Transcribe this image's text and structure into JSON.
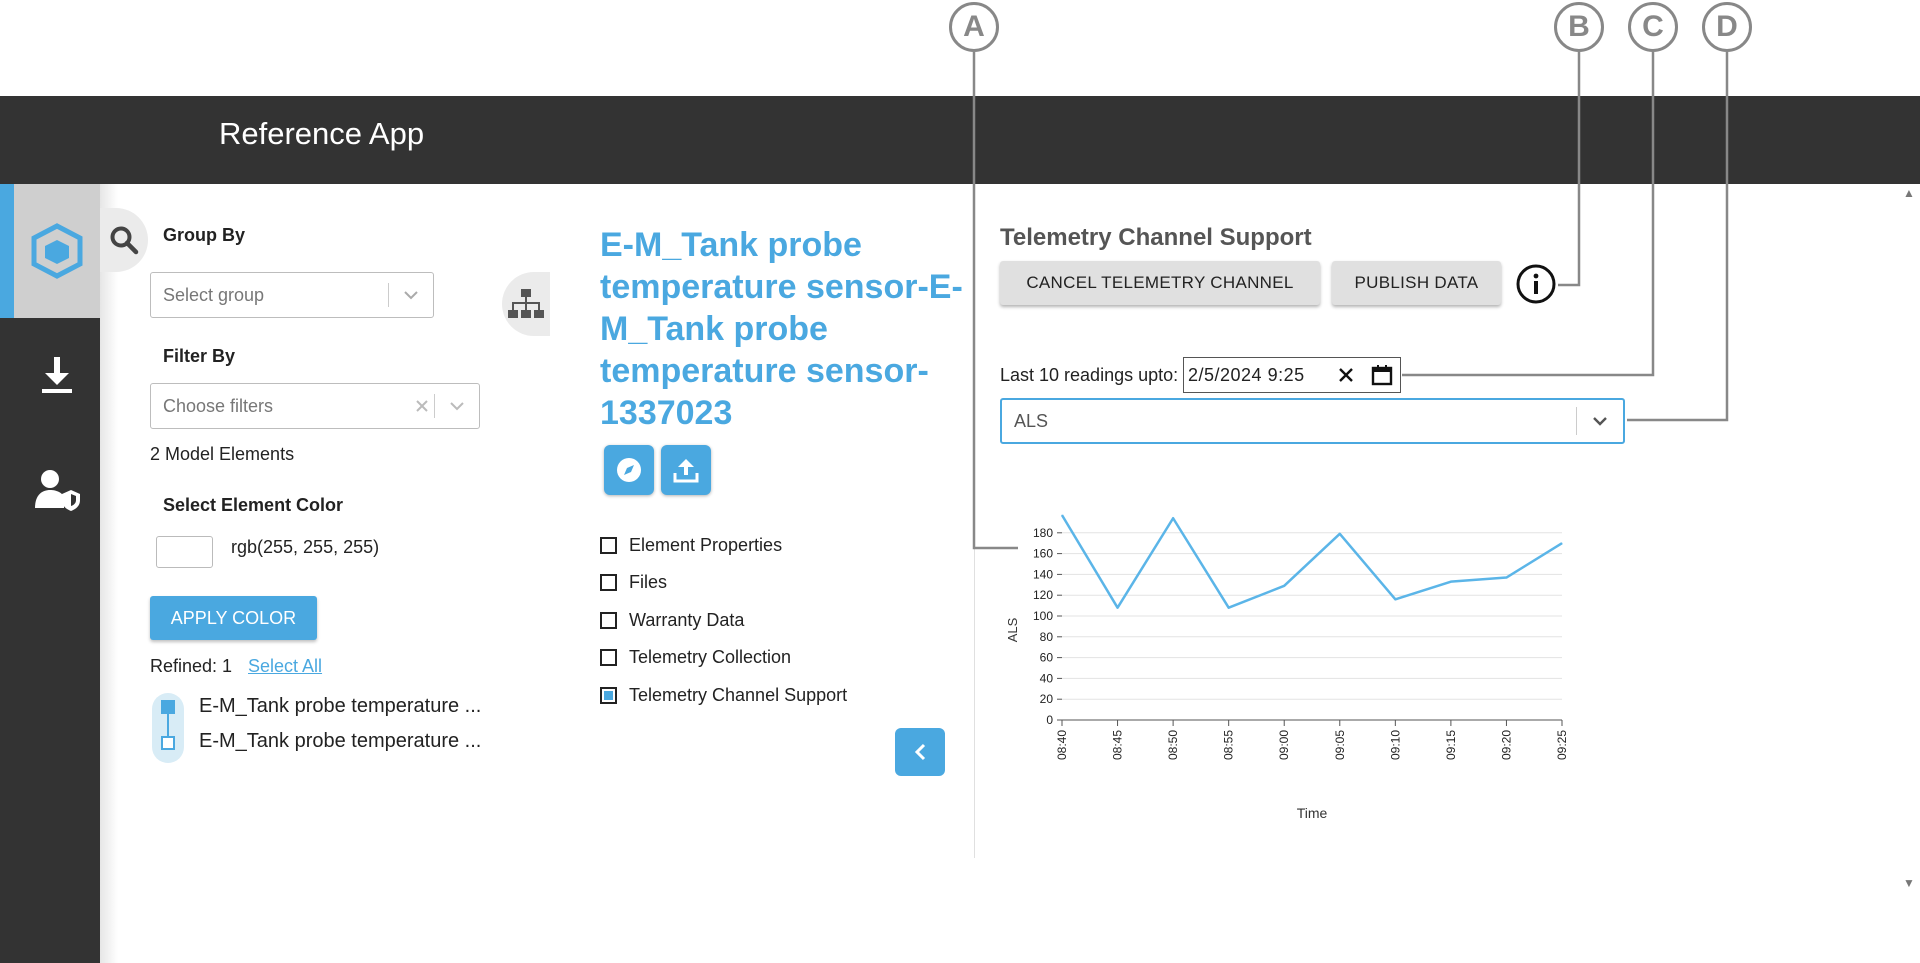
{
  "app": {
    "title": "Reference App"
  },
  "nav": {
    "items": [
      {
        "icon": "cube-icon"
      },
      {
        "icon": "download-icon"
      },
      {
        "icon": "user-shield-icon"
      }
    ]
  },
  "left_panel": {
    "group_by_label": "Group By",
    "group_placeholder": "Select group",
    "filter_by_label": "Filter By",
    "filter_placeholder": "Choose filters",
    "model_count": "2 Model Elements",
    "color_label": "Select Element Color",
    "color_value": "rgb(255, 255, 255)",
    "apply_label": "APPLY COLOR",
    "refined": "Refined: 1",
    "select_all": "Select All",
    "tree_items": [
      {
        "label": "E-M_Tank probe temperature ..."
      },
      {
        "label": "E-M_Tank probe temperature ..."
      }
    ]
  },
  "middle": {
    "element_title": "E-M_Tank probe temperature sensor-E-M_Tank probe temperature sensor-1337023",
    "checkboxes": [
      {
        "label": "Element Properties",
        "checked": false
      },
      {
        "label": "Files",
        "checked": false
      },
      {
        "label": "Warranty Data",
        "checked": false
      },
      {
        "label": "Telemetry Collection",
        "checked": false
      },
      {
        "label": "Telemetry Channel Support",
        "checked": true
      }
    ]
  },
  "right": {
    "title": "Telemetry Channel Support",
    "cancel_label": "CANCEL TELEMETRY CHANNEL",
    "publish_label": "PUBLISH DATA",
    "readings_label": "Last 10 readings upto:",
    "date_value": "2/5/2024  9:25",
    "channel_value": "ALS"
  },
  "callouts": [
    "A",
    "B",
    "C",
    "D"
  ],
  "colors": {
    "accent": "#4aa8e0",
    "header": "#333333",
    "line": "#5bb5e8"
  },
  "chart_data": {
    "type": "line",
    "xlabel": "Time",
    "ylabel": "ALS",
    "x": [
      "08:40",
      "08:45",
      "08:50",
      "08:55",
      "09:00",
      "09:05",
      "09:10",
      "09:15",
      "09:20",
      "09:25"
    ],
    "series": [
      {
        "values": [
          197,
          108,
          194,
          108,
          129,
          179,
          116,
          133,
          137,
          170
        ]
      }
    ],
    "ylim": [
      0,
      200
    ],
    "yticks": [
      0,
      20,
      40,
      60,
      80,
      100,
      120,
      140,
      160,
      180
    ],
    "grid": true
  }
}
